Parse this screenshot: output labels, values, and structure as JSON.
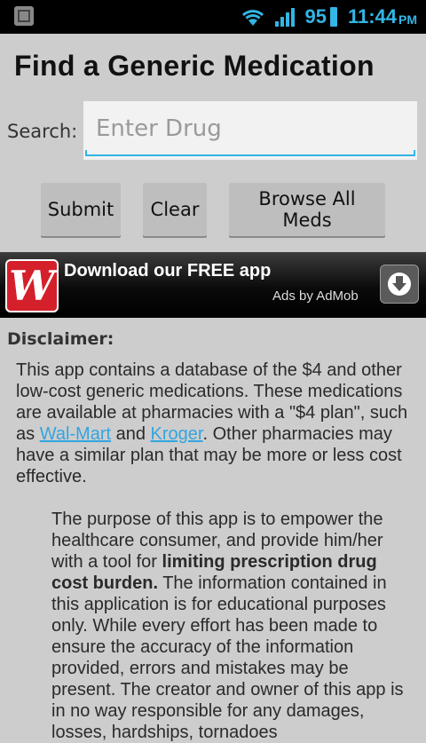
{
  "status_bar": {
    "battery": "95",
    "time": "11:44",
    "ampm": "PM",
    "icons": [
      "chip-icon",
      "wifi-icon",
      "signal-icon",
      "battery-icon"
    ],
    "accent_color": "#33b5e5"
  },
  "header": {
    "title": "Find a Generic Medication"
  },
  "search": {
    "label": "Search:",
    "placeholder": "Enter Drug",
    "value": ""
  },
  "buttons": {
    "submit": "Submit",
    "clear": "Clear",
    "browse": "Browse All Meds"
  },
  "ad": {
    "logo_letter": "W",
    "headline": "Download our FREE app",
    "by": "Ads by AdMob",
    "icon": "download-icon"
  },
  "disclaimer": {
    "title": "Disclaimer:",
    "p1_a": "This app contains a database of the $4 and other low-cost generic medications. These medications are available at pharmacies with a \"$4 plan\", such as ",
    "link_walmart": "Wal-Mart",
    "p1_and": " and ",
    "link_kroger": "Kroger",
    "p1_b": ". Other pharmacies may have a similar plan that may be more or less cost effective.",
    "p2_a": "The purpose of this app is to empower the healthcare consumer, and provide him/her with a tool for ",
    "p2_bold": "limiting prescription drug cost burden.",
    "p2_b": " The information contained in this application is for educational purposes only. While every effort has been made to ensure the accuracy of the information provided, errors and mistakes may be present. The creator and owner of this app is in no way responsible for any damages, losses, hardships, tornadoes"
  }
}
